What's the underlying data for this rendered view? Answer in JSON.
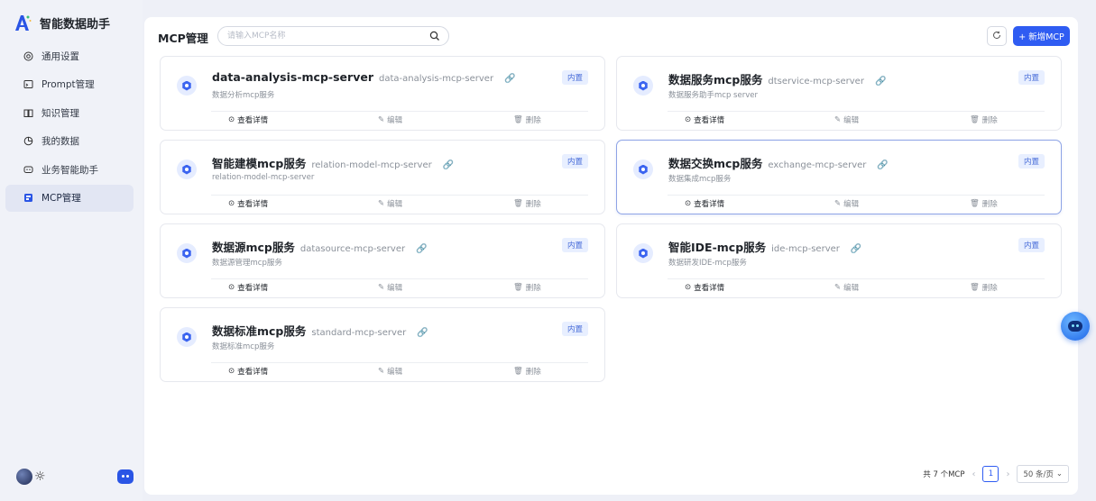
{
  "brand": {
    "title": "智能数据助手"
  },
  "sidebar": {
    "items": [
      {
        "label": "通用设置",
        "icon": "settings-circle-icon",
        "active": false
      },
      {
        "label": "Prompt管理",
        "icon": "prompt-icon",
        "active": false
      },
      {
        "label": "知识管理",
        "icon": "book-icon",
        "active": false
      },
      {
        "label": "我的数据",
        "icon": "pie-chart-icon",
        "active": false
      },
      {
        "label": "业务智能助手",
        "icon": "chat-bubble-icon",
        "active": false
      },
      {
        "label": "MCP管理",
        "icon": "mcp-icon",
        "active": true
      }
    ]
  },
  "header": {
    "title": "MCP管理",
    "search_placeholder": "请输入MCP名称",
    "add_label": "+ 新增MCP"
  },
  "cards": [
    {
      "name": "data-analysis-mcp-server",
      "code": "data-analysis-mcp-server",
      "desc": "数据分析mcp服务",
      "badge": "内置",
      "view": "查看详情",
      "edit": "编辑",
      "delete": "删除"
    },
    {
      "name": "数据服务mcp服务",
      "code": "dtservice-mcp-server",
      "desc": "数据服务助手mcp server",
      "badge": "内置",
      "view": "查看详情",
      "edit": "编辑",
      "delete": "删除"
    },
    {
      "name": "智能建模mcp服务",
      "code": "relation-model-mcp-server",
      "desc": "relation-model-mcp-server",
      "badge": "内置",
      "view": "查看详情",
      "edit": "编辑",
      "delete": "删除"
    },
    {
      "name": "数据交换mcp服务",
      "code": "exchange-mcp-server",
      "desc": "数据集成mcp服务",
      "badge": "内置",
      "view": "查看详情",
      "edit": "编辑",
      "delete": "删除"
    },
    {
      "name": "数据源mcp服务",
      "code": "datasource-mcp-server",
      "desc": "数据源管理mcp服务",
      "badge": "内置",
      "view": "查看详情",
      "edit": "编辑",
      "delete": "删除"
    },
    {
      "name": "智能IDE-mcp服务",
      "code": "ide-mcp-server",
      "desc": "数据研发IDE-mcp服务",
      "badge": "内置",
      "view": "查看详情",
      "edit": "编辑",
      "delete": "删除"
    },
    {
      "name": "数据标准mcp服务",
      "code": "standard-mcp-server",
      "desc": "数据标准mcp服务",
      "badge": "内置",
      "view": "查看详情",
      "edit": "编辑",
      "delete": "删除"
    }
  ],
  "pagination": {
    "total": "共 7 个MCP",
    "current_page": "1",
    "page_size": "50 条/页"
  },
  "colors": {
    "primary": "#2f5cf2",
    "badge_bg": "#e8efff",
    "link": "#7dc36a"
  }
}
